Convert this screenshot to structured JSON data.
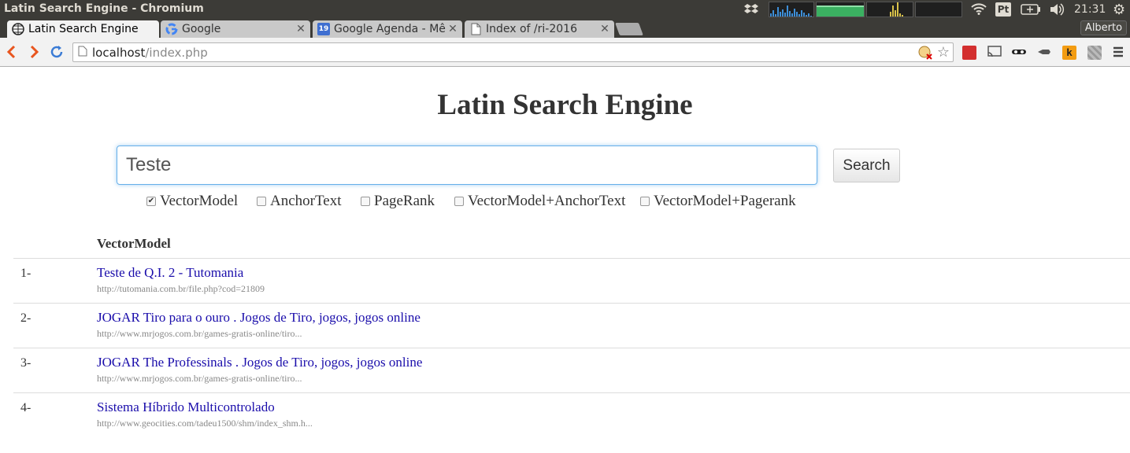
{
  "os": {
    "window_title": "Latin Search Engine - Chromium",
    "keyboard_layout": "Pt",
    "clock": "21:31"
  },
  "browser": {
    "tabs": [
      {
        "label": "Latin Search Engine",
        "icon": "globe-icon"
      },
      {
        "label": "Google",
        "icon": "google-icon"
      },
      {
        "label": "Google Agenda - Mê",
        "icon": "calendar-icon",
        "badge": "19"
      },
      {
        "label": "Index of /ri-2016",
        "icon": "document-icon"
      }
    ],
    "profile_name": "Alberto",
    "url_host": "localhost",
    "url_path": "/index.php"
  },
  "page": {
    "title": "Latin Search Engine",
    "search_value": "Teste",
    "search_button": "Search",
    "options": [
      {
        "label": "VectorModel",
        "checked": true
      },
      {
        "label": "AnchorText",
        "checked": false
      },
      {
        "label": "PageRank",
        "checked": false
      },
      {
        "label": "VectorModel+AnchorText",
        "checked": false
      },
      {
        "label": "VectorModel+Pagerank",
        "checked": false
      }
    ],
    "results_header": "VectorModel",
    "results": [
      {
        "num": "1-",
        "title": "Teste de Q.I. 2 - Tutomania",
        "url": "http://tutomania.com.br/file.php?cod=21809"
      },
      {
        "num": "2-",
        "title": "JOGAR Tiro para o ouro . Jogos de Tiro, jogos, jogos online",
        "url": "http://www.mrjogos.com.br/games-gratis-online/tiro..."
      },
      {
        "num": "3-",
        "title": "JOGAR The Professinals . Jogos de Tiro, jogos, jogos online",
        "url": "http://www.mrjogos.com.br/games-gratis-online/tiro..."
      },
      {
        "num": "4-",
        "title": "Sistema Híbrido Multicontrolado",
        "url": "http://www.geocities.com/tadeu1500/shm/index_shm.h..."
      }
    ]
  },
  "colors": {
    "link": "#1a0dab",
    "accent_orange": "#e8551e",
    "input_focus": "#66afe9"
  }
}
